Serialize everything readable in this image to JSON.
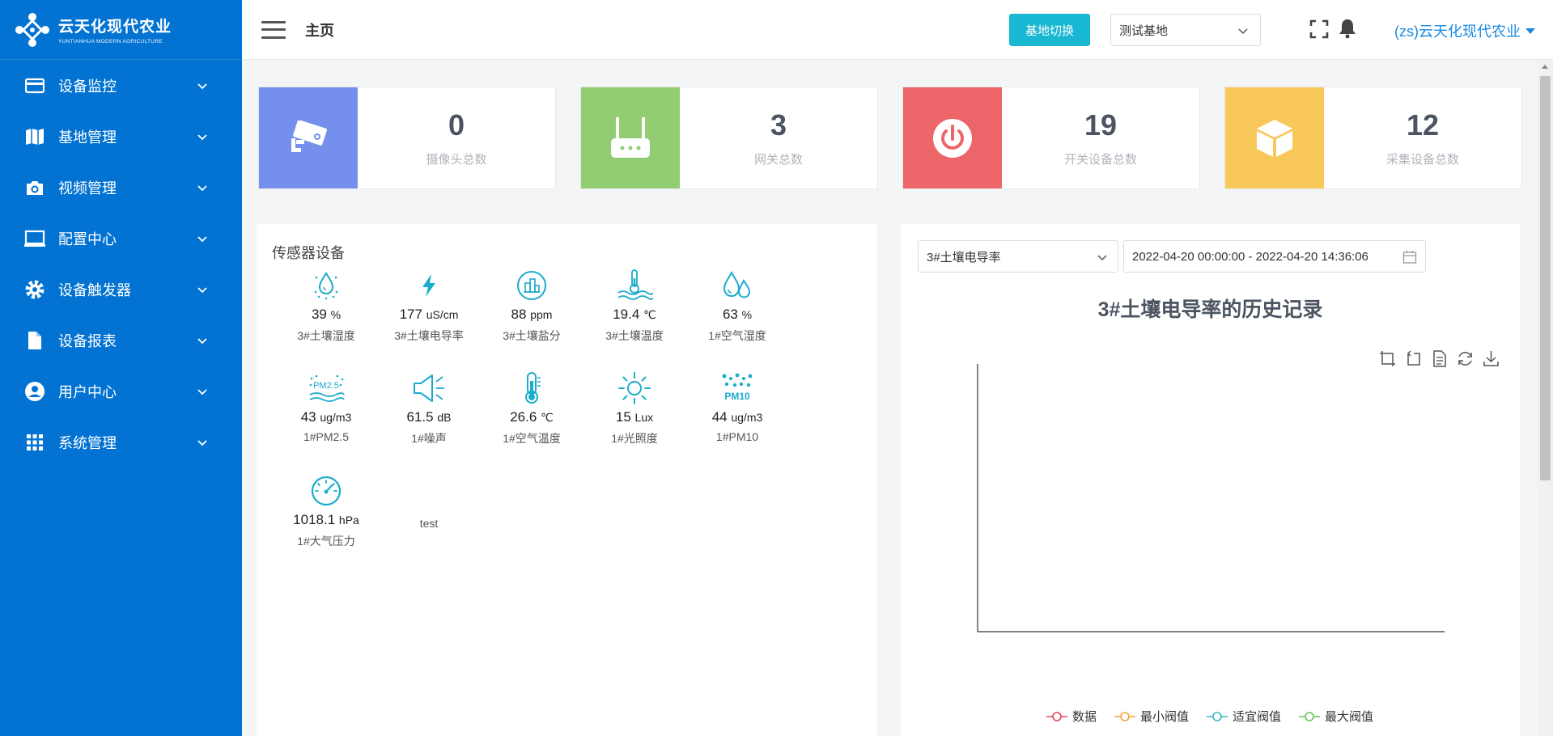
{
  "logo": {
    "cn": "云天化现代农业",
    "en": "YUNTIANHUA MODERN AGRICULTURE"
  },
  "sidebar": {
    "items": [
      {
        "label": "设备监控",
        "icon": "card-icon"
      },
      {
        "label": "基地管理",
        "icon": "map-icon"
      },
      {
        "label": "视频管理",
        "icon": "camera-icon"
      },
      {
        "label": "配置中心",
        "icon": "monitor-icon"
      },
      {
        "label": "设备触发器",
        "icon": "gear-icon"
      },
      {
        "label": "设备报表",
        "icon": "document-icon"
      },
      {
        "label": "用户中心",
        "icon": "user-icon"
      },
      {
        "label": "系统管理",
        "icon": "grid-icon"
      }
    ]
  },
  "header": {
    "title": "主页",
    "switch_label": "基地切换",
    "base_selected": "测试基地",
    "user": "(zs)云天化现代农业"
  },
  "stats": [
    {
      "value": "0",
      "label": "摄像头总数",
      "color": "#7490ec",
      "icon": "camera-icon"
    },
    {
      "value": "3",
      "label": "网关总数",
      "color": "#92cd74",
      "icon": "router-icon"
    },
    {
      "value": "19",
      "label": "开关设备总数",
      "color": "#ec6669",
      "icon": "power-icon"
    },
    {
      "value": "12",
      "label": "采集设备总数",
      "color": "#f9c85a",
      "icon": "box-icon"
    }
  ],
  "sensor_panel": {
    "title": "传感器设备",
    "sensors": [
      {
        "value": "39",
        "unit": "%",
        "name": "3#土壤湿度",
        "icon": "soil-moisture-icon"
      },
      {
        "value": "177",
        "unit": "uS/cm",
        "name": "3#土壤电导率",
        "icon": "lightning-icon"
      },
      {
        "value": "88",
        "unit": "ppm",
        "name": "3#土壤盐分",
        "icon": "salt-icon"
      },
      {
        "value": "19.4",
        "unit": "℃",
        "name": "3#土壤温度",
        "icon": "soil-temperature-icon"
      },
      {
        "value": "63",
        "unit": "%",
        "name": "1#空气湿度",
        "icon": "water-drops-icon"
      },
      {
        "value": "43",
        "unit": "ug/m3",
        "name": "1#PM2.5",
        "icon": "pm25-icon",
        "badge": "PM2.5"
      },
      {
        "value": "61.5",
        "unit": "dB",
        "name": "1#噪声",
        "icon": "speaker-icon"
      },
      {
        "value": "26.6",
        "unit": "℃",
        "name": "1#空气温度",
        "icon": "thermometer-icon"
      },
      {
        "value": "15",
        "unit": "Lux",
        "name": "1#光照度",
        "icon": "sun-icon"
      },
      {
        "value": "44",
        "unit": "ug/m3",
        "name": "1#PM10",
        "icon": "pm10-icon",
        "badge": "PM10"
      },
      {
        "value": "1018.1",
        "unit": "hPa",
        "name": "1#大气压力",
        "icon": "gauge-icon"
      }
    ],
    "test_label": "test"
  },
  "chart_panel": {
    "metric_selected": "3#土壤电导率",
    "date_range": "2022-04-20 00:00:00 - 2022-04-20 14:36:06"
  },
  "chart_data": {
    "type": "line",
    "title": "3#土壤电导率的历史记录",
    "x": [],
    "series": [
      {
        "name": "数据",
        "color": "#e6455e",
        "values": []
      },
      {
        "name": "最小阀值",
        "color": "#f0a23a",
        "values": []
      },
      {
        "name": "适宜阀值",
        "color": "#35b9c5",
        "values": []
      },
      {
        "name": "最大阀值",
        "color": "#6cc05c",
        "values": []
      }
    ],
    "legend_position": "bottom"
  }
}
